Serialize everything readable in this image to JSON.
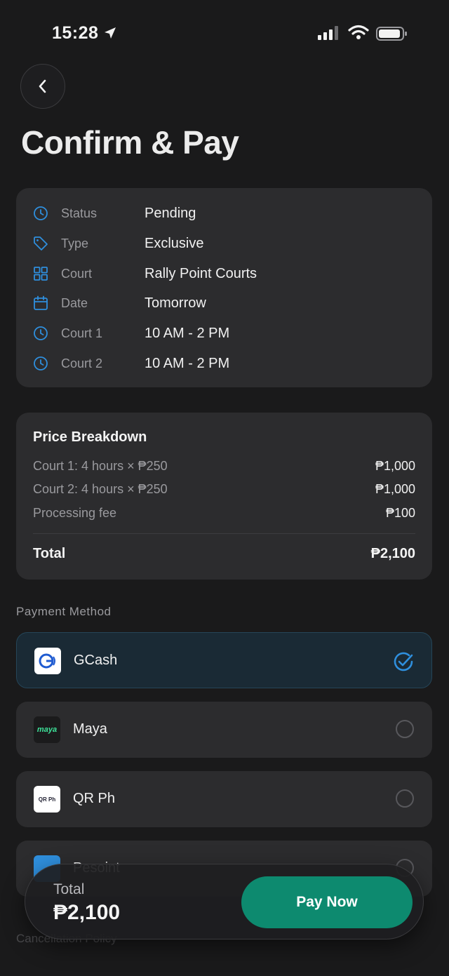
{
  "status_bar": {
    "time": "15:28"
  },
  "header": {
    "title": "Confirm & Pay"
  },
  "booking_info": [
    {
      "label": "Status",
      "value": "Pending",
      "icon": "clock-icon"
    },
    {
      "label": "Type",
      "value": "Exclusive",
      "icon": "tag-icon"
    },
    {
      "label": "Court",
      "value": "Rally Point Courts",
      "icon": "grid-icon"
    },
    {
      "label": "Date",
      "value": "Tomorrow",
      "icon": "calendar-icon"
    },
    {
      "label": "Court 1",
      "value": "10 AM - 2 PM",
      "icon": "clock-icon"
    },
    {
      "label": "Court 2",
      "value": "10 AM - 2 PM",
      "icon": "clock-icon"
    }
  ],
  "price_breakdown": {
    "title": "Price Breakdown",
    "items": [
      {
        "label": "Court 1: 4 hours × ₱250",
        "amount": "₱1,000"
      },
      {
        "label": "Court 2: 4 hours × ₱250",
        "amount": "₱1,000"
      },
      {
        "label": "Processing fee",
        "amount": "₱100"
      }
    ],
    "total_label": "Total",
    "total_amount": "₱2,100"
  },
  "payment": {
    "section_label": "Payment Method",
    "methods": [
      {
        "name": "GCash",
        "selected": true,
        "logo_text": "G"
      },
      {
        "name": "Maya",
        "selected": false,
        "logo_text": "maya"
      },
      {
        "name": "QR Ph",
        "selected": false,
        "logo_text": "QR Ph"
      },
      {
        "name": "Pesoint",
        "selected": false
      }
    ]
  },
  "footer": {
    "total_label": "Total",
    "total_amount": "₱2,100",
    "pay_button": "Pay Now",
    "next_section_hint": "Cancellation Policy"
  },
  "colors": {
    "accent": "#2f8fdd",
    "pay_button": "#0d8a6f",
    "background": "#1a1a1b",
    "card": "#2c2c2e"
  }
}
